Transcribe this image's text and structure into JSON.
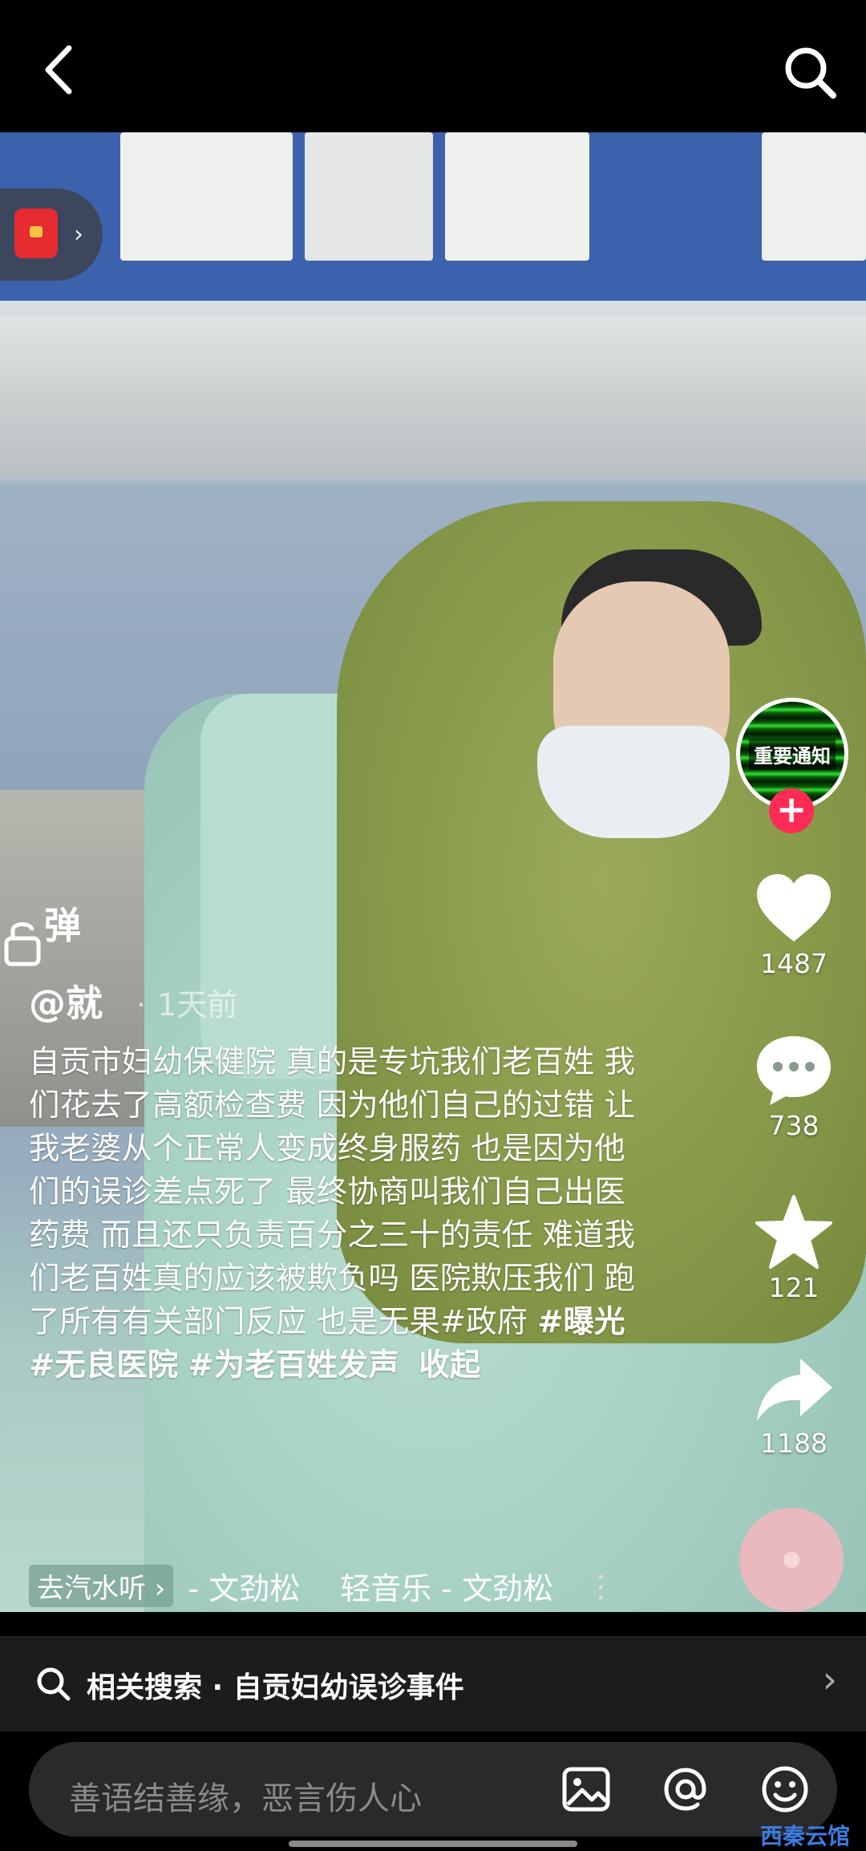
{
  "topbar": {
    "back_icon": "chevron-left-icon",
    "search_icon": "search-icon"
  },
  "side": {
    "avatar_text": "重要通知",
    "likes": "1487",
    "comments": "738",
    "favorites": "121",
    "shares": "1188"
  },
  "danmu": {
    "label": "弹"
  },
  "post": {
    "author": "@就",
    "time": "1天前",
    "desc_plain": "自贡市妇幼保健院 真的是专坑我们老百姓 我们花去了高额检查费 因为他们自己的过错 让我老婆从个正常人变成终身服药 也是因为他们的误诊差点死了 最终协商叫我们自己出医药费 而且还只负责百分之三十的责任 难道我们老百姓真的应该被欺负吗 医院欺压我们 跑了所有有关部门反应 也是无果#政府 ",
    "tag1": "#曝光",
    "tag2": "#无良医院",
    "tag3": "#为老百姓发声",
    "collapse": "收起"
  },
  "music": {
    "tag": "去汽水听 ›",
    "text": "- 文劲松　 轻音乐 - 文劲松",
    "more": "⋮"
  },
  "related": {
    "label": "相关搜索 · 自贡妇幼误诊事件",
    "chevron": "›"
  },
  "input": {
    "placeholder": "善语结善缘，恶言伤人心"
  },
  "watermark": "西秦云馆",
  "colors": {
    "follow": "#fe2c55",
    "redpacket": "#e62b31"
  }
}
